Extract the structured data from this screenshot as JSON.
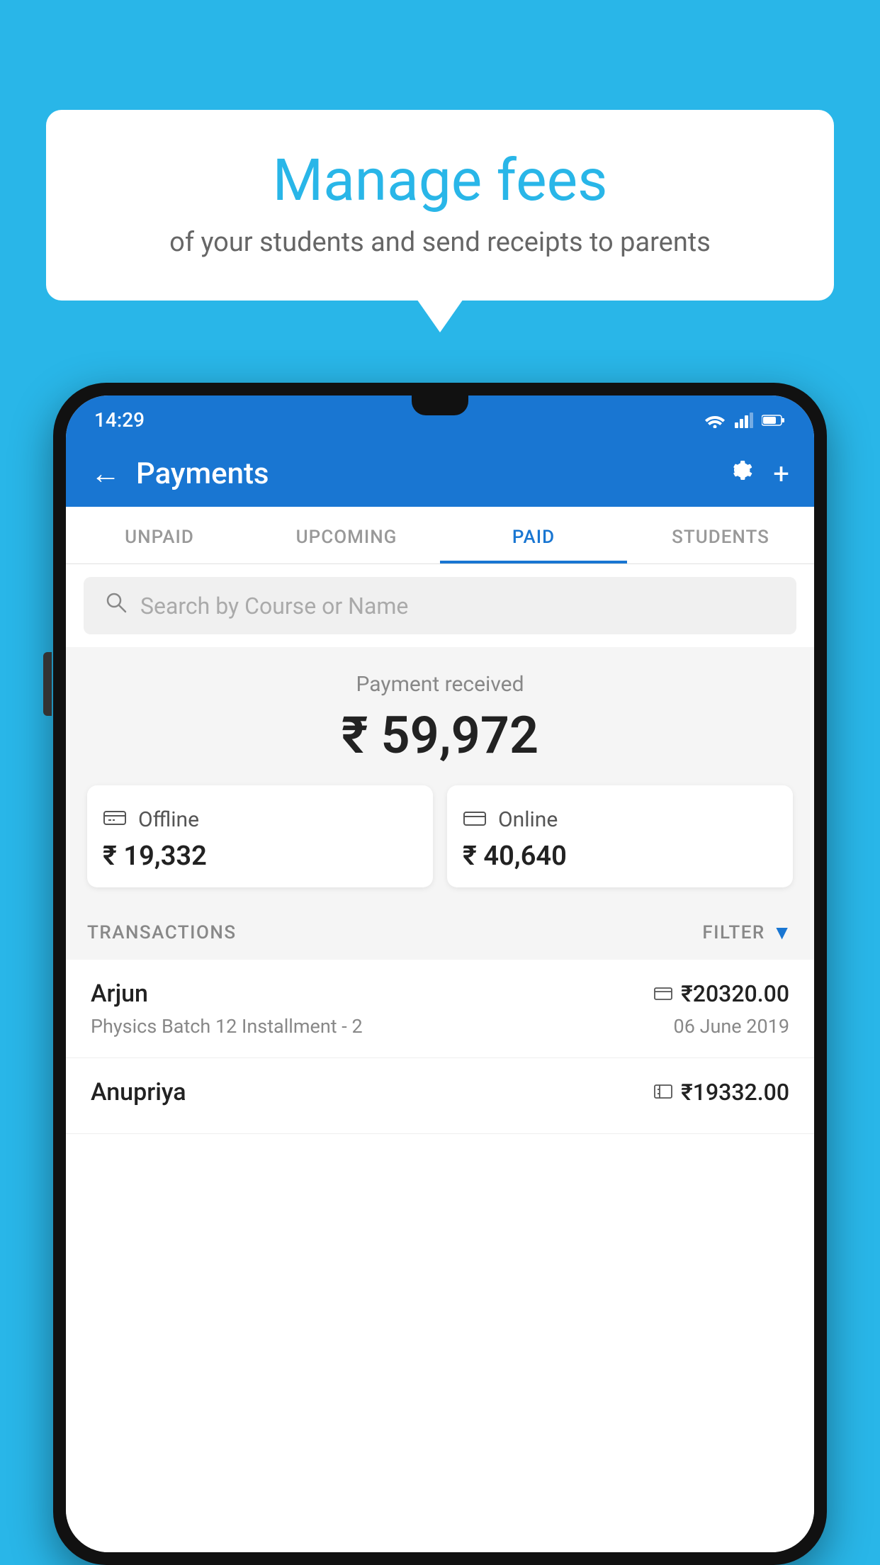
{
  "background": {
    "color": "#29b6e8"
  },
  "speech_bubble": {
    "heading": "Manage fees",
    "subtext": "of your students and send receipts to parents"
  },
  "status_bar": {
    "time": "14:29"
  },
  "app_bar": {
    "title": "Payments",
    "back_label": "←",
    "gear_label": "⚙",
    "plus_label": "+"
  },
  "tabs": [
    {
      "label": "UNPAID",
      "active": false
    },
    {
      "label": "UPCOMING",
      "active": false
    },
    {
      "label": "PAID",
      "active": true
    },
    {
      "label": "STUDENTS",
      "active": false
    }
  ],
  "search": {
    "placeholder": "Search by Course or Name"
  },
  "payment_summary": {
    "label": "Payment received",
    "total": "₹ 59,972",
    "offline_label": "Offline",
    "offline_amount": "₹ 19,332",
    "online_label": "Online",
    "online_amount": "₹ 40,640"
  },
  "transactions": {
    "header_label": "TRANSACTIONS",
    "filter_label": "FILTER",
    "items": [
      {
        "name": "Arjun",
        "amount": "₹20320.00",
        "course": "Physics Batch 12 Installment - 2",
        "date": "06 June 2019",
        "payment_type": "online"
      },
      {
        "name": "Anupriya",
        "amount": "₹19332.00",
        "course": "",
        "date": "",
        "payment_type": "offline"
      }
    ]
  }
}
